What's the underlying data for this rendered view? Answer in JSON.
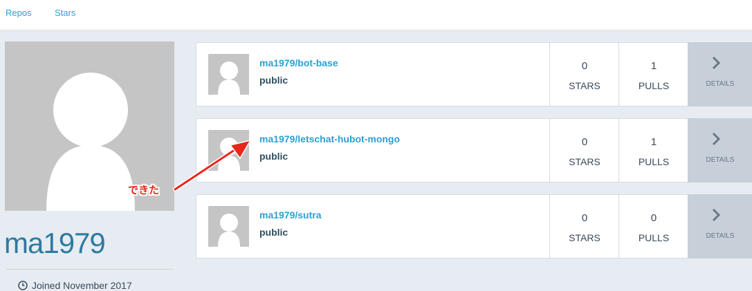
{
  "nav": {
    "repos": "Repos",
    "stars": "Stars"
  },
  "profile": {
    "username": "ma1979",
    "joined": "Joined November 2017",
    "avatar_icon": "default-user-silhouette"
  },
  "repos": [
    {
      "name": "ma1979/bot-base",
      "visibility": "public",
      "stars": "0",
      "stars_label": "STARS",
      "pulls": "1",
      "pulls_label": "PULLS",
      "details_label": "DETAILS"
    },
    {
      "name": "ma1979/letschat-hubot-mongo",
      "visibility": "public",
      "stars": "0",
      "stars_label": "STARS",
      "pulls": "1",
      "pulls_label": "PULLS",
      "details_label": "DETAILS"
    },
    {
      "name": "ma1979/sutra",
      "visibility": "public",
      "stars": "0",
      "stars_label": "STARS",
      "pulls": "0",
      "pulls_label": "PULLS",
      "details_label": "DETAILS"
    }
  ],
  "annotation": {
    "text": "できた",
    "color": "#e8261a"
  },
  "colors": {
    "link": "#2b9fd5",
    "background": "#e6ecf1",
    "details_bg": "#c7cfd9"
  }
}
